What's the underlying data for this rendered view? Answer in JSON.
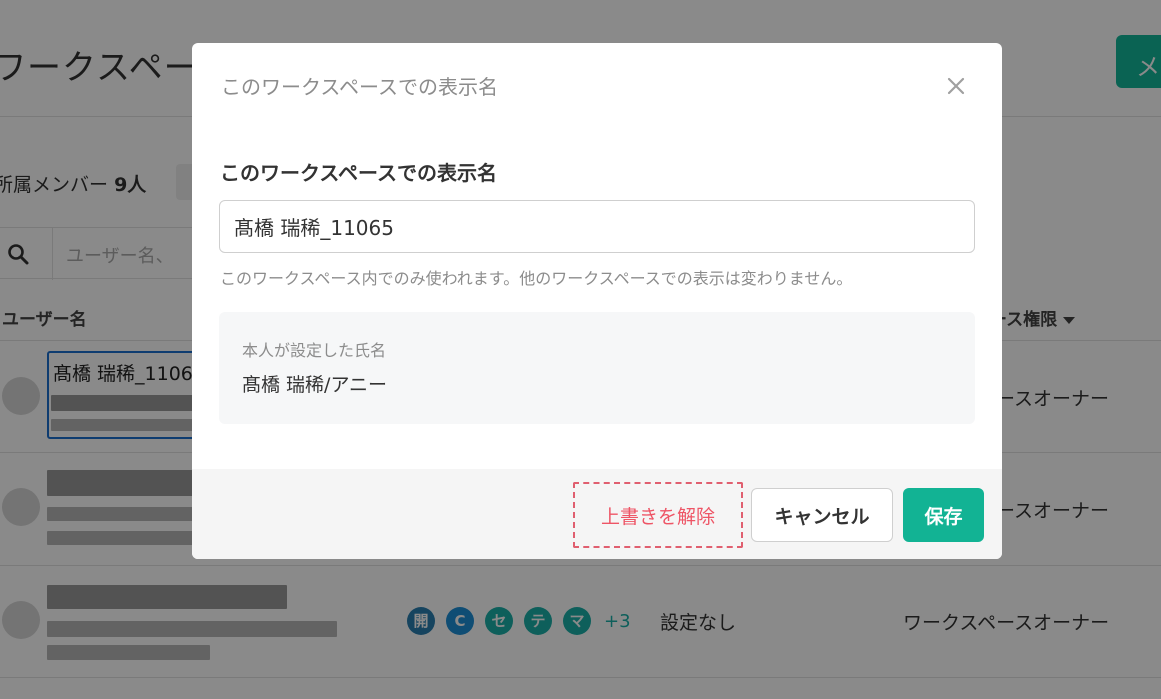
{
  "background": {
    "page_title": "ワークスペース",
    "top_button_label": "メ",
    "members_label": "所属メンバー",
    "members_count": "9人",
    "search_placeholder": "ユーザー名、",
    "column_user": "ユーザー名",
    "column_role": "ース権限",
    "editing_cell_value": "髙橋 瑞稀_1106",
    "rows": [
      {
        "role": "ースオーナー"
      },
      {
        "role": "ースオーナー"
      },
      {
        "role": "ワークスペースオーナー",
        "setting": "設定なし",
        "tags": [
          "開",
          "C",
          "セ",
          "テ",
          "マ"
        ],
        "tags_more": "+3"
      }
    ]
  },
  "modal": {
    "title": "このワークスペースでの表示名",
    "field_label": "このワークスペースでの表示名",
    "input_value": "髙橋 瑞稀_11065",
    "helper_text": "このワークスペース内でのみ使われます。他のワークスペースでの表示は変わりません。",
    "self_name_label": "本人が設定した氏名",
    "self_name_value": "髙橋 瑞稀/アニー",
    "buttons": {
      "unset": "上書きを解除",
      "cancel": "キャンセル",
      "save": "保存"
    }
  },
  "icons": {
    "close": "close-icon",
    "search": "search-icon"
  },
  "colors": {
    "accent": "#12b394",
    "danger": "#ee5566",
    "focus": "#1b6fd0"
  }
}
